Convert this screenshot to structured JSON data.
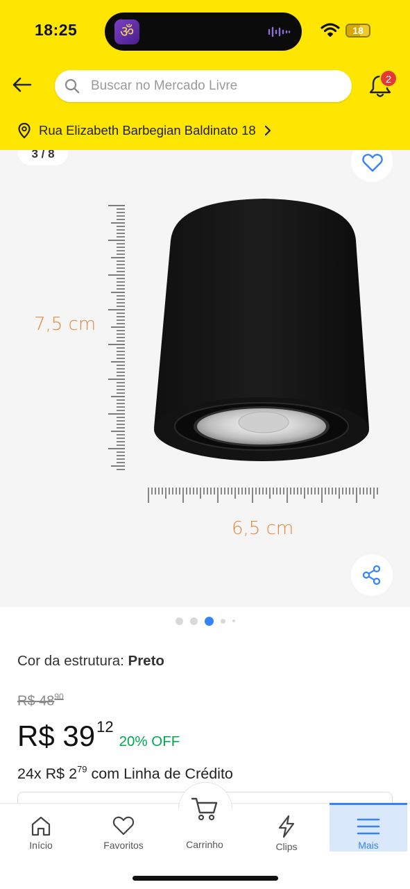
{
  "status_bar": {
    "time": "18:25",
    "battery": "18",
    "icons": [
      "app-icon",
      "audio-wave-icon",
      "wifi-icon",
      "battery-icon"
    ]
  },
  "header": {
    "search_placeholder": "Buscar no Mercado Livre",
    "notifications_count": "2",
    "location": "Rua Elizabeth Barbegian Baldinato 18",
    "icons": [
      "back-arrow-icon",
      "search-icon",
      "bell-icon",
      "pin-icon",
      "chevron-right-icon"
    ]
  },
  "gallery": {
    "counter": "3 / 8",
    "current_index": 3,
    "total_images": 8,
    "height_label": "7,5 cm",
    "width_label": "6,5 cm",
    "icons": [
      "heart-icon",
      "share-icon"
    ]
  },
  "product": {
    "color_label": "Cor da estrutura: ",
    "color_value": "Preto",
    "old_price_main": "R$ 48",
    "old_price_cents": "90",
    "price_main": "R$ 39",
    "price_cents": "12",
    "discount": "20% OFF",
    "installment_prefix": "24x R$ 2",
    "installment_cents": "79",
    "installment_suffix": " com Linha de Crédito"
  },
  "bottom_nav": {
    "items": [
      {
        "label": "Início",
        "icon": "home-icon"
      },
      {
        "label": "Favoritos",
        "icon": "heart-icon"
      },
      {
        "label": "Carrinho",
        "icon": "cart-icon"
      },
      {
        "label": "Clips",
        "icon": "lightning-icon"
      },
      {
        "label": "Mais",
        "icon": "menu-icon"
      }
    ],
    "active": "Mais"
  },
  "colors": {
    "header_bg": "#FFE600",
    "accent_blue": "#3483FA",
    "discount_green": "#00a650",
    "dimension_orange": "#e8843a",
    "badge_red": "#e53935"
  }
}
